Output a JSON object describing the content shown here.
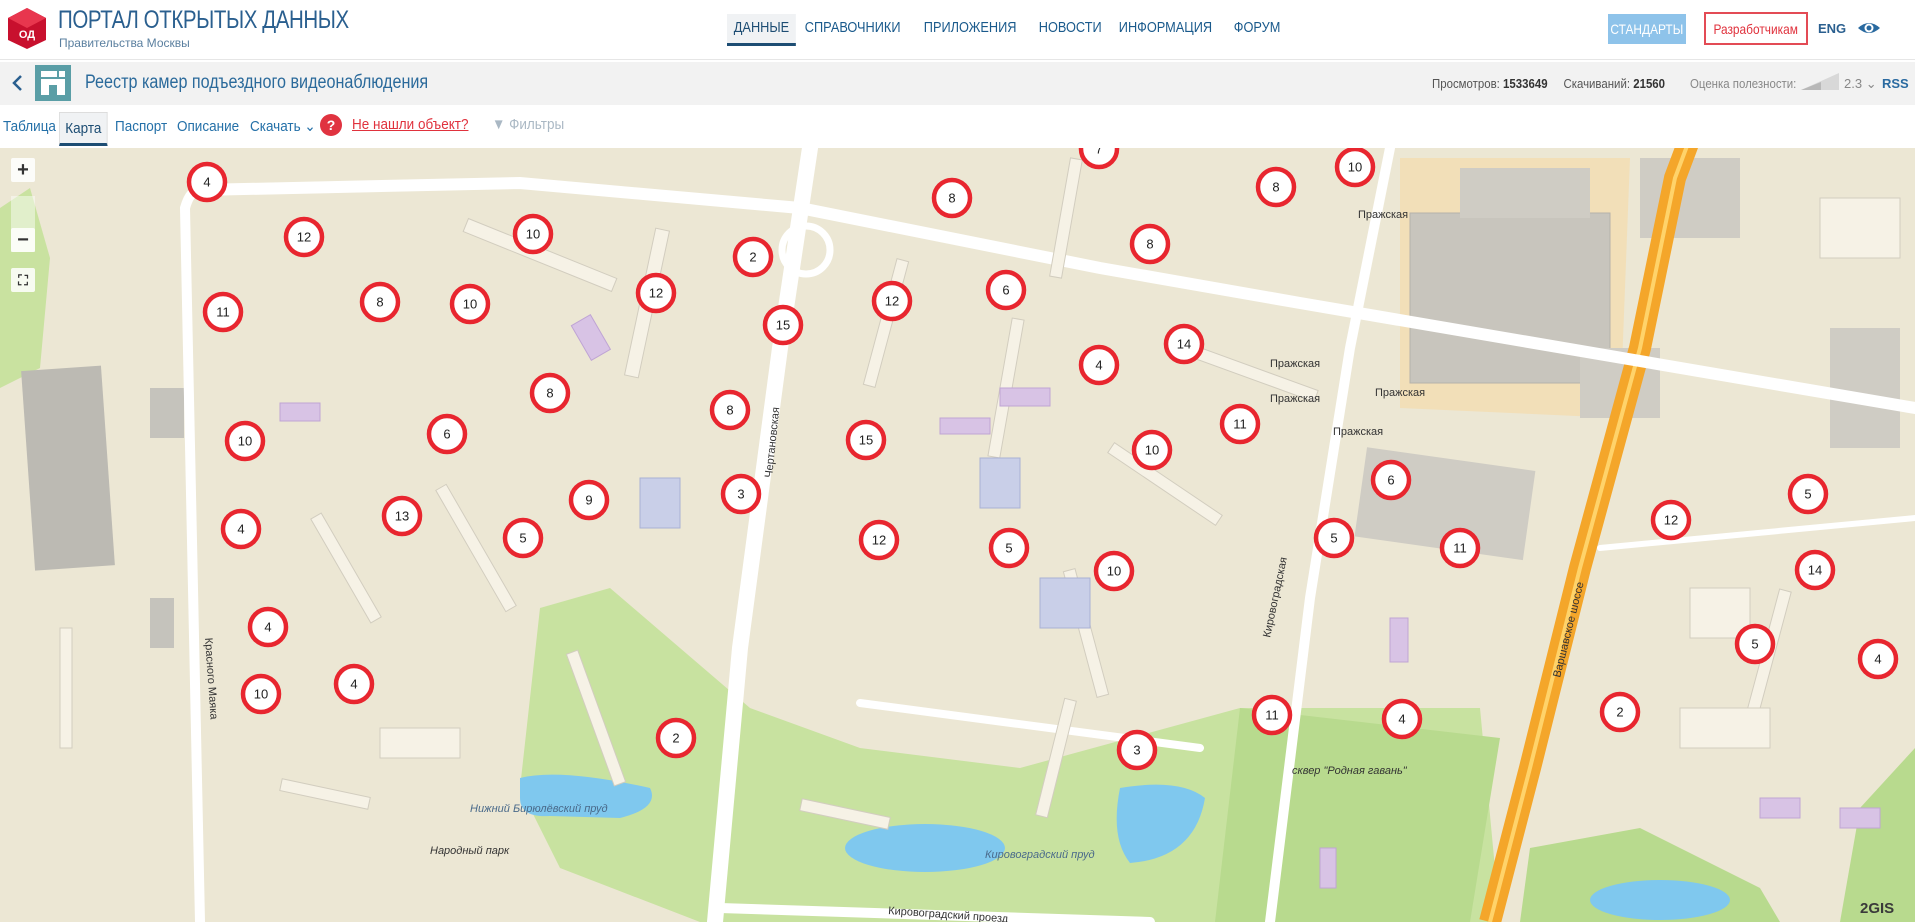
{
  "header": {
    "title": "ПОРТАЛ ОТКРЫТЫХ ДАННЫХ",
    "subtitle": "Правительства Москвы",
    "logo_text": "ОД",
    "nav": [
      {
        "label": "ДАННЫЕ",
        "active": true
      },
      {
        "label": "СПРАВОЧНИКИ"
      },
      {
        "label": "ПРИЛОЖЕНИЯ"
      },
      {
        "label": "НОВОСТИ"
      },
      {
        "label": "ИНФОРМАЦИЯ"
      },
      {
        "label": "ФОРУМ"
      }
    ],
    "standards_label": "СТАНДАРТЫ",
    "developers_label": "Разработчикам",
    "lang_label": "ENG",
    "accent": "#1d4d73",
    "red": "#e0323d"
  },
  "dataset": {
    "title": "Реестр камер подъездного видеонаблюдения",
    "views_label": "Просмотров:",
    "views": "1533649",
    "downloads_label": "Скачиваний:",
    "downloads": "21560",
    "rating_label": "Оценка полезности:",
    "rating": "2.3",
    "rss_label": "RSS"
  },
  "tabs": {
    "table": "Таблица",
    "map": "Карта",
    "passport": "Паспорт",
    "description": "Описание",
    "download": "Скачать",
    "help": "?",
    "not_found": "Не нашли объект?",
    "filters": "Фильтры"
  },
  "map": {
    "attribution": "2GIS",
    "zoom_in": "+",
    "zoom_out": "−",
    "labels": [
      "Пражская",
      "Пражская",
      "Пражская",
      "Пражская",
      "Пражская",
      "Кировоградская",
      "Варшавское шоссе",
      "Чертановская",
      "Красного Маяка",
      "Нижний Бирюлёвский пруд",
      "Народный парк",
      "Кировоградский пруд",
      "Кировоградский проезд",
      "сквер \"Родная гавань\""
    ],
    "clusters": [
      {
        "n": "4"
      },
      {
        "n": "12"
      },
      {
        "n": "10"
      },
      {
        "n": "8"
      },
      {
        "n": "11"
      },
      {
        "n": "10"
      },
      {
        "n": "2"
      },
      {
        "n": "12"
      },
      {
        "n": "15"
      },
      {
        "n": "8"
      },
      {
        "n": "12"
      },
      {
        "n": "8"
      },
      {
        "n": "6"
      },
      {
        "n": "7"
      },
      {
        "n": "8"
      },
      {
        "n": "10"
      },
      {
        "n": "8"
      },
      {
        "n": "4"
      },
      {
        "n": "14"
      },
      {
        "n": "8"
      },
      {
        "n": "6"
      },
      {
        "n": "10"
      },
      {
        "n": "15"
      },
      {
        "n": "3"
      },
      {
        "n": "9"
      },
      {
        "n": "13"
      },
      {
        "n": "5"
      },
      {
        "n": "4"
      },
      {
        "n": "12"
      },
      {
        "n": "5"
      },
      {
        "n": "10"
      },
      {
        "n": "11"
      },
      {
        "n": "10"
      },
      {
        "n": "6"
      },
      {
        "n": "5"
      },
      {
        "n": "11"
      },
      {
        "n": "4"
      },
      {
        "n": "4"
      },
      {
        "n": "10"
      },
      {
        "n": "2"
      },
      {
        "n": "11"
      },
      {
        "n": "4"
      },
      {
        "n": "3"
      },
      {
        "n": "5"
      },
      {
        "n": "12"
      },
      {
        "n": "14"
      },
      {
        "n": "5"
      },
      {
        "n": "4"
      },
      {
        "n": "2"
      }
    ]
  }
}
